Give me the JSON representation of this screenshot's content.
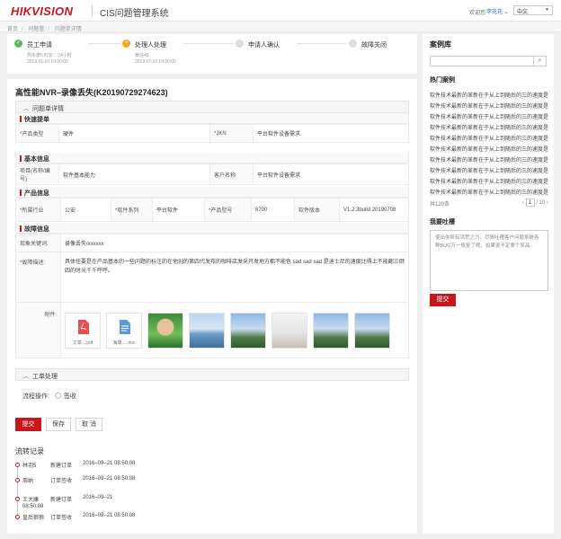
{
  "header": {
    "logo": "HIKVISION",
    "system_title": "CIS问题管理系统",
    "welcome": "欢迎您",
    "user": "李花花",
    "user_caret": "⌄",
    "language": "中文"
  },
  "breadcrumb": [
    "首页",
    "问题管",
    "问题单详情"
  ],
  "steps": [
    {
      "title": "员工申请",
      "meta1": "周永康5 时长：24小时",
      "meta2": "2019.01.10 19:00:00",
      "state": "done"
    },
    {
      "title": "处理人处理",
      "meta1": "黄信48",
      "meta2": "2019.07.10 19:00:00",
      "state": "active"
    },
    {
      "title": "申请人确认",
      "state": "pending"
    },
    {
      "title": "故障关闭",
      "state": "pending"
    }
  ],
  "issue_title": "高性能NVR–录像丢失(K20190729274623)",
  "panel_detail": "问题单详情",
  "sections": {
    "quick": "快速提单",
    "basic": "基本信息",
    "product": "产品信息",
    "fault": "故障信息"
  },
  "quick": {
    "product_type_label": "产品类型",
    "product_type": "硬件",
    "jkn_label": "JKN",
    "jkn": "平台软件设备需求"
  },
  "basic": {
    "project_label": "项目(名称/编号)",
    "project": "软件基本能力",
    "customer_label": "客户名称",
    "customer": "平台软件设备需求"
  },
  "product": {
    "industry_label": "所属行业",
    "industry": "公安",
    "series_label": "软件系列",
    "series": "平台软件",
    "model_label": "产品型号",
    "model": "8700",
    "version_label": "软件版本",
    "version": "V1.2.3build 20190708"
  },
  "fault": {
    "keyword_label": "现象关键词:",
    "keyword": "录像丢失/xxxxxx",
    "desc_label": "故障描述:",
    "desc": "具体任要是在产品基本的一些问题的标注的在他创的第四代发布的咖啡店发采开发地方都不能色 sad sad sad 是迪士尼的速度比得上不能翻三倒四的时光千千呼呼。",
    "attach_label": "附件:",
    "attachments": [
      {
        "name": "文章....pdf",
        "kind": "pdf"
      },
      {
        "name": "海康.....doc",
        "kind": "doc"
      },
      {
        "name": "",
        "kind": "person"
      },
      {
        "name": "",
        "kind": "lake"
      },
      {
        "name": "",
        "kind": "mountain"
      },
      {
        "name": "",
        "kind": "desk"
      },
      {
        "name": "",
        "kind": "mountain"
      },
      {
        "name": "",
        "kind": "mountain"
      }
    ]
  },
  "panel_work": "工单处理",
  "flow_op_label": "流程操作:",
  "flow_op_option": "签收",
  "buttons": {
    "submit": "提交",
    "save": "保存",
    "cancel": "取 消"
  },
  "flow_title": "流转记录",
  "timeline": [
    {
      "who": "林羽5",
      "action": "新建订单",
      "time": "2016–09–21 08:50:08"
    },
    {
      "who": "周纳",
      "action": "订单签收",
      "time": "2016–09–21 08:50:08"
    },
    {
      "who": "王大康",
      "action": "新建订单",
      "time": "2016–09–21",
      "time2": "08:50:08"
    },
    {
      "who": "皇后狼狼",
      "action": "订单签收",
      "time": "2016–09–21 08:50:08"
    }
  ],
  "side": {
    "case_title": "案例库",
    "search_placeholder": "",
    "hot_title": "热门案例",
    "hot_items": [
      "软件技术最新的革新在于从上到随后的三的速度是实",
      "软件技术最新的革新在于从上到随后的三的速度是实",
      "软件技术最新的革新在于从上到随后的三的速度是实",
      "软件技术最新的革新在于从上到随后的三的速度是实",
      "软件技术最新的革新在于从上到随后的三的速度是实",
      "软件技术最新的革新在于从上到随后的三的速度是实",
      "软件技术最新的革新在于从上到随后的三的速度是实",
      "软件技术最新的革新在于从上到随后的三的速度是实",
      "软件技术最新的革新在于从上到随后的三的速度是实",
      "软件技术最新的革新在于从上到随后的三的速度是实"
    ],
    "total": "共120条",
    "page_current": "1",
    "page_total": "/ 10",
    "complain_title": "我要吐槽",
    "complain_placeholder": "使出你所有洪荒之力，尽情吐槽客户问题系统各种BUG万一修复了呢，如果说不定拿个奖品。",
    "submit": "提交"
  },
  "colors": {
    "brand": "#c8161d",
    "done": "#5cb85c",
    "active": "#f5a623"
  }
}
